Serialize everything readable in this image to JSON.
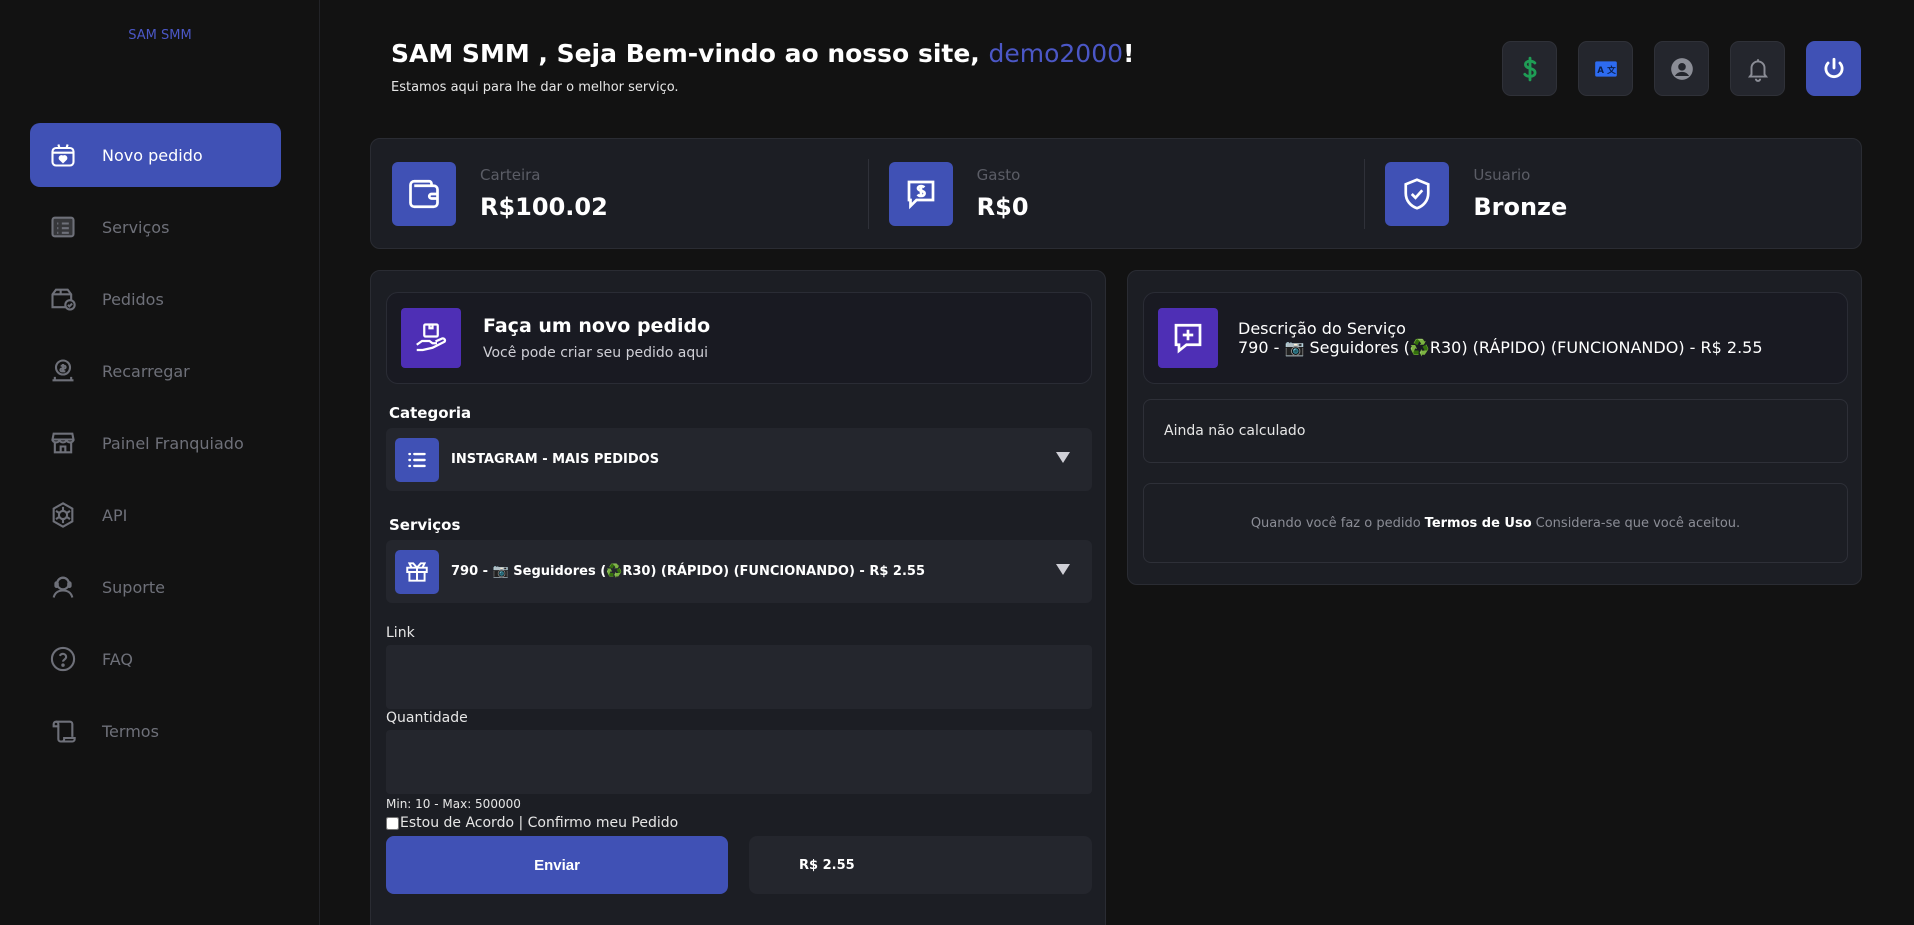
{
  "brand": "SAM SMM",
  "sidebar": {
    "items": [
      {
        "label": "Novo pedido",
        "icon": "heart-box-icon"
      },
      {
        "label": "Serviços",
        "icon": "list-icon"
      },
      {
        "label": "Pedidos",
        "icon": "package-check-icon"
      },
      {
        "label": "Recarregar",
        "icon": "money-hand-icon"
      },
      {
        "label": "Painel Franquiado",
        "icon": "store-icon"
      },
      {
        "label": "API",
        "icon": "api-gear-icon"
      },
      {
        "label": "Suporte",
        "icon": "support-icon"
      },
      {
        "label": "FAQ",
        "icon": "question-icon"
      },
      {
        "label": "Termos",
        "icon": "scroll-icon"
      }
    ]
  },
  "header": {
    "welcome_prefix": "SAM SMM , Seja Bem-vindo ao nosso site, ",
    "username": "demo2000",
    "welcome_suffix": "!",
    "subtitle": "Estamos aqui para lhe dar o melhor serviço."
  },
  "topbar": {
    "buttons": [
      "dollar-icon",
      "translate-icon",
      "user-icon",
      "bell-icon",
      "power-icon"
    ],
    "colors": {
      "dollar": "#1f9d55",
      "translate": "#2d6bf0",
      "power": "#4051b5"
    }
  },
  "stats": [
    {
      "label": "Carteira",
      "value": "R$100.02"
    },
    {
      "label": "Gasto",
      "value": "R$0"
    },
    {
      "label": "Usuario",
      "value": "Bronze"
    }
  ],
  "order": {
    "title": "Faça um novo pedido",
    "subtitle": "Você pode criar seu pedido aqui",
    "category_label": "Categoria",
    "category_value": "INSTAGRAM - MAIS PEDIDOS",
    "services_label": "Serviços",
    "service_value": "790 - 📷 Seguidores (♻️R30) (RÁPIDO) (FUNCIONANDO) - R$ 2.55",
    "link_label": "Link",
    "link_value": "",
    "quantity_label": "Quantidade",
    "quantity_value": "",
    "minmax": "Min: 10 - Max: 500000",
    "agree_label": "Estou de Acordo | Confirmo meu Pedido",
    "submit_label": "Enviar",
    "price": "R$ 2.55"
  },
  "description": {
    "title": "Descrição do Serviço",
    "service": "790 - 📷 Seguidores (♻️R30) (RÁPIDO) (FUNCIONANDO) - R$ 2.55",
    "calc_status": "Ainda não calculado",
    "terms_prefix": "Quando você faz o pedido",
    "terms_link": "Termos de Uso",
    "terms_suffix": "Considera-se que você aceitou."
  },
  "colors": {
    "accent": "#4051b5",
    "accent_purple": "#4e2fb5",
    "background": "#121212",
    "panel": "#1c1e24"
  }
}
